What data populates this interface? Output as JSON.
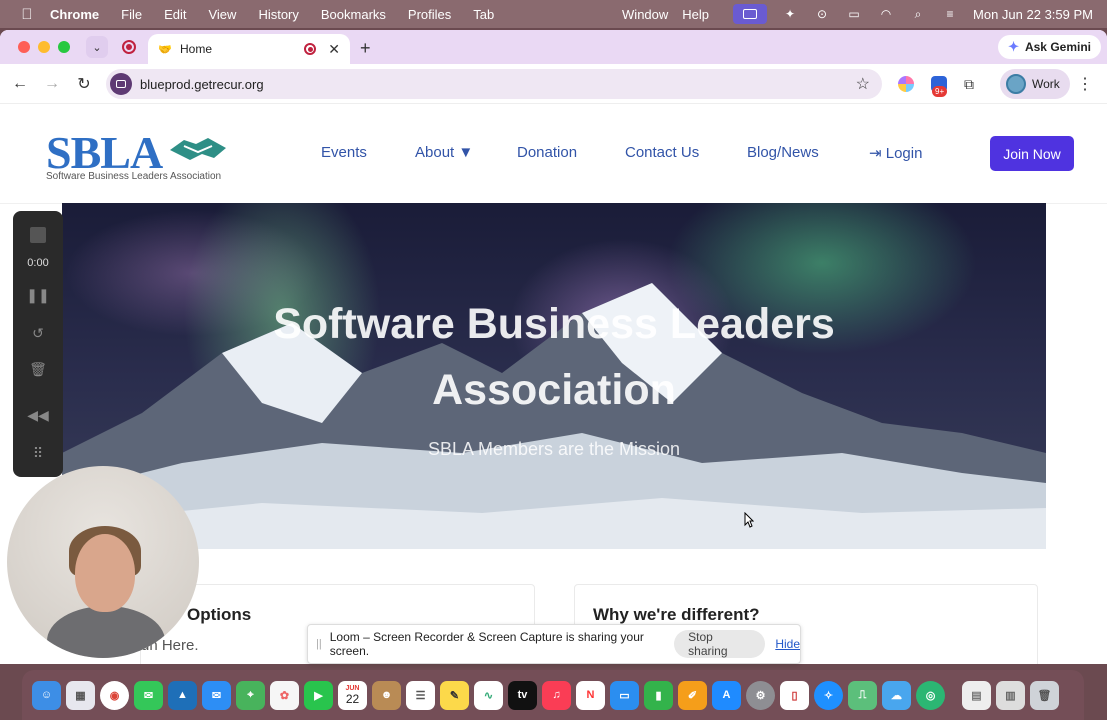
{
  "menubar": {
    "app": "Chrome",
    "items": [
      "File",
      "Edit",
      "View",
      "History",
      "Bookmarks",
      "Profiles",
      "Tab",
      "Window",
      "Help"
    ],
    "clock": "Mon Jun 22  3:59 PM"
  },
  "browser": {
    "tab_title": "Home",
    "ask_gemini": "Ask Gemini",
    "url": "blueprod.getrecur.org",
    "profile_name": "Work",
    "ext_badge": "9+"
  },
  "site": {
    "logo_text": "SBLA",
    "logo_tagline": "Software Business Leaders Association",
    "nav": {
      "events": "Events",
      "about": "About ▼",
      "donation": "Donation",
      "contact": "Contact Us",
      "blog": "Blog/News",
      "login": "Login"
    },
    "join_label": "Join Now",
    "hero_title_line1": "Software Business Leaders",
    "hero_title_line2": "Association",
    "hero_subtitle": "SBLA Members are the Mission",
    "card1_title": "Options",
    "card1_link": "un Here.",
    "card2_title": "Why we're different?"
  },
  "loom": {
    "timer": "0:00",
    "share_message": "Loom – Screen Recorder & Screen Capture is sharing your screen.",
    "stop_label": "Stop sharing",
    "hide_label": "Hide"
  },
  "dock": {
    "calendar_month": "JUN",
    "calendar_day": "22"
  },
  "colors": {
    "brand_blue": "#2f6fc4",
    "nav_blue": "#3254a8",
    "join_purple": "#4f33e0",
    "tab_strip": "#ead9f4"
  }
}
